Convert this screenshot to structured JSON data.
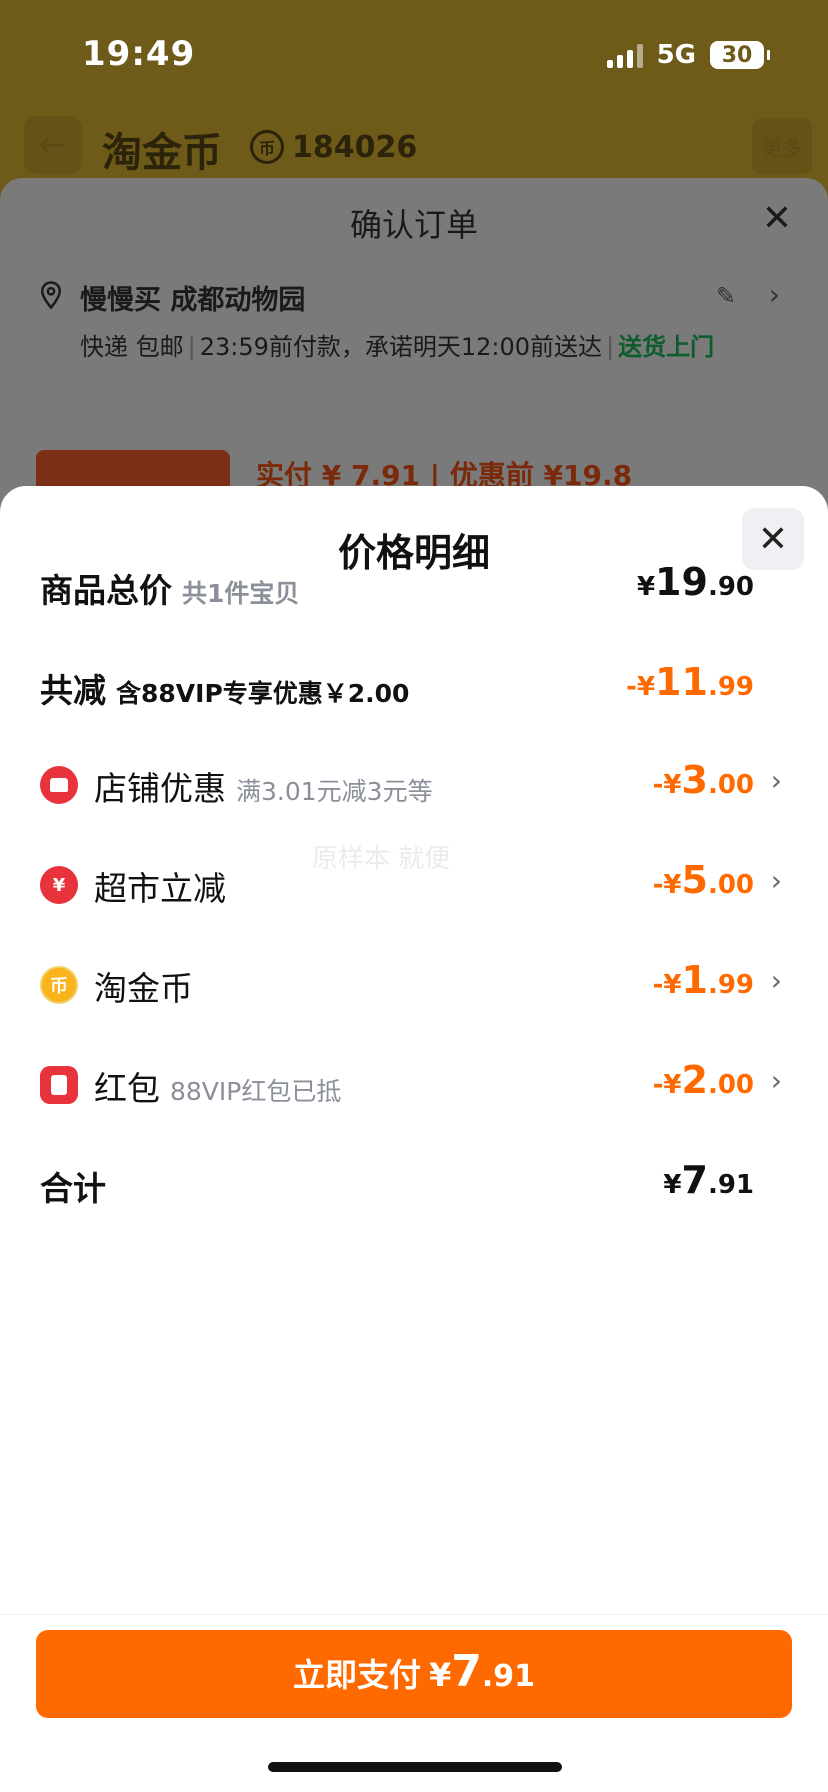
{
  "status_bar": {
    "time": "19:49",
    "network": "5G",
    "battery": "30"
  },
  "app_header": {
    "title": "淘金币",
    "coin_count": "184026",
    "more_label": "更多"
  },
  "confirm_order": {
    "title": "确认订单",
    "address_name": "慢慢买 成都动物园",
    "delivery": "快递 包邮",
    "deadline": "23:59前付款，承诺明天12:00前送达",
    "delivery_tag": "送货上门",
    "promo_price": "实付 ¥ 7.91 | 优惠前 ¥19.8"
  },
  "price_detail": {
    "title": "价格明细",
    "rows": [
      {
        "label": "商品总价",
        "sub": "共1件宝贝",
        "currency": "¥",
        "int": "19",
        "dec": ".90"
      },
      {
        "label": "共减",
        "sub": "含88VIP专享优惠￥2.00",
        "currency": "-¥",
        "int": "11",
        "dec": ".99"
      },
      {
        "label": "店铺优惠",
        "sub": "满3.01元减3元等",
        "currency": "-¥",
        "int": "3",
        "dec": ".00",
        "icon": "shop-icon"
      },
      {
        "label": "超市立减",
        "sub": "",
        "currency": "-¥",
        "int": "5",
        "dec": ".00",
        "icon": "yuan-icon"
      },
      {
        "label": "淘金币",
        "sub": "",
        "currency": "-¥",
        "int": "1",
        "dec": ".99",
        "icon": "coin-icon"
      },
      {
        "label": "红包",
        "sub": "88VIP红包已抵",
        "currency": "-¥",
        "int": "2",
        "dec": ".00",
        "icon": "red-packet-icon"
      },
      {
        "label": "合计",
        "sub": "",
        "currency": "¥",
        "int": "7",
        "dec": ".91"
      }
    ],
    "watermark": "原样本 就便"
  },
  "pay_button": {
    "label": "立即支付",
    "currency": "¥",
    "int": "7",
    "dec": ".91"
  },
  "colors": {
    "accent": "#ff6a00",
    "green": "#0c5c2c",
    "red_icon": "#e8323c",
    "coin_icon": "#f9b31b"
  }
}
